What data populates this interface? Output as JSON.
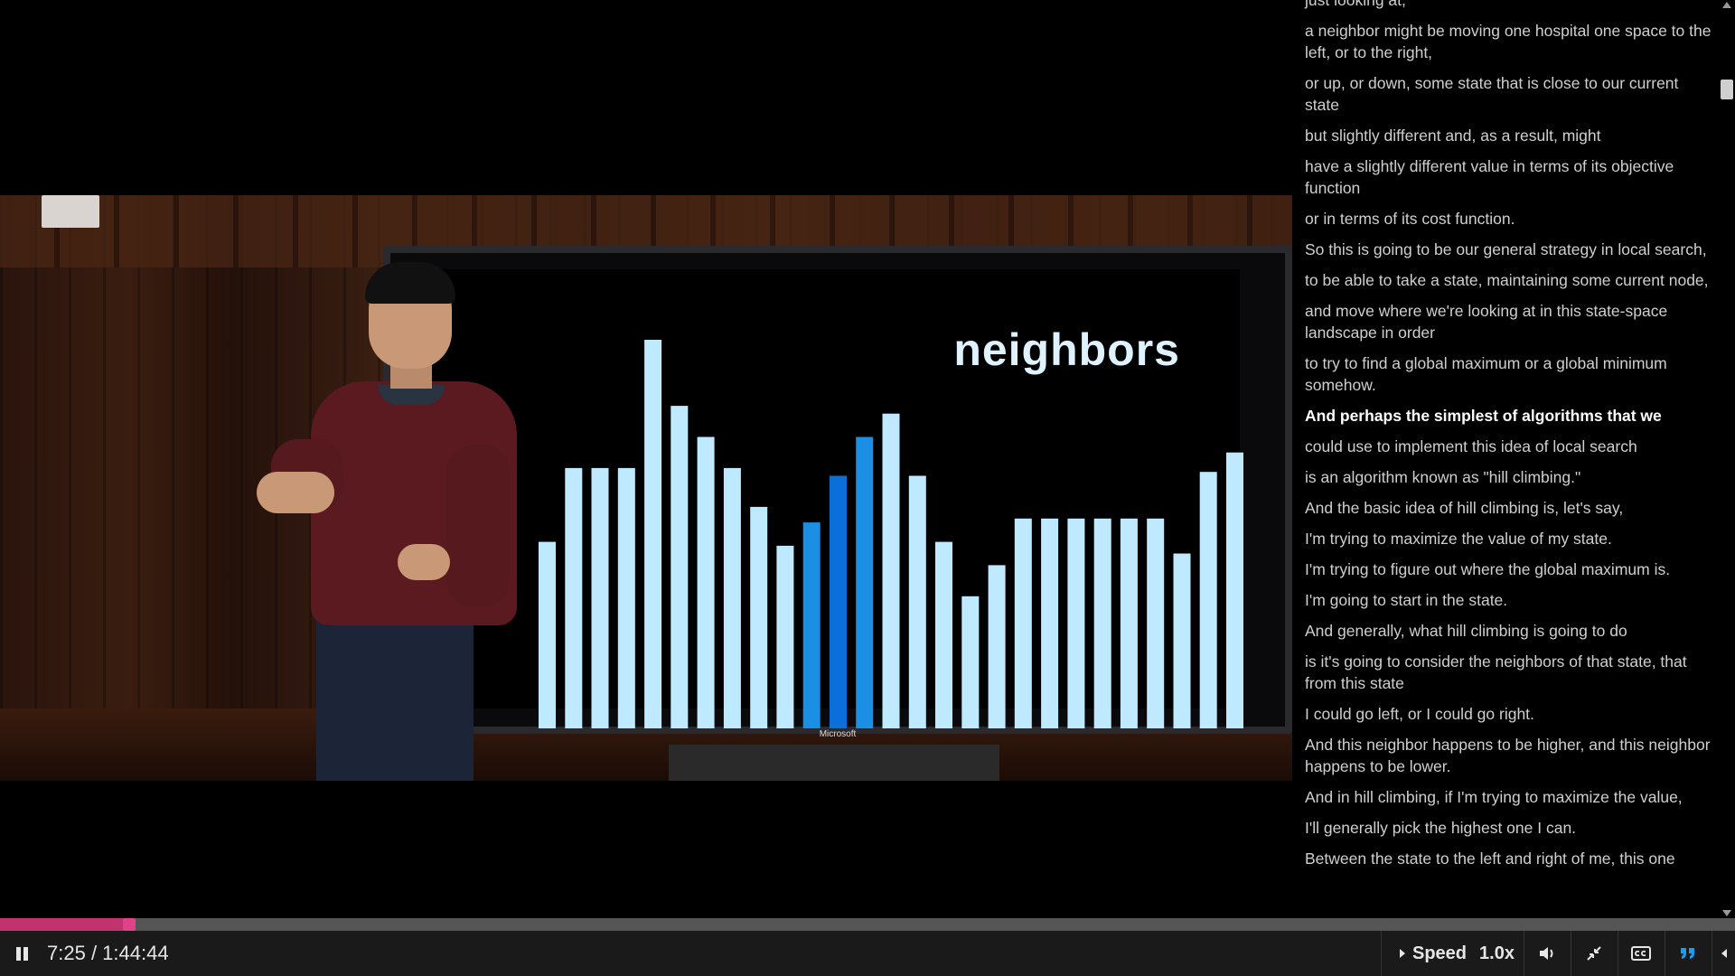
{
  "slide": {
    "title": "neighbors",
    "brand": "Microsoft"
  },
  "bars": {
    "values": [
      0.48,
      0.67,
      0.67,
      0.67,
      1.0,
      0.83,
      0.75,
      0.67,
      0.57,
      0.47,
      0.53,
      0.65,
      0.75,
      0.81,
      0.65,
      0.48,
      0.34,
      0.42,
      0.54,
      0.54,
      0.54,
      0.54,
      0.54,
      0.54,
      0.45,
      0.66,
      0.71
    ],
    "highlight": [
      10,
      11,
      12
    ],
    "colors": {
      "normal": "#bfe9ff",
      "highlight_light": "#1a8fe3",
      "highlight_dark": "#0a6fd8"
    }
  },
  "transcript": {
    "lines": [
      "just looking at,",
      "a neighbor might be moving one hospital one space to the left, or to the right,",
      "or up, or down, some state that is close to our current state",
      "but slightly different and, as a result, might",
      "have a slightly different value in terms of its objective function",
      "or in terms of its cost function.",
      "So this is going to be our general strategy in local search,",
      "to be able to take a state, maintaining some current node,",
      "and move where we're looking at in this state-space landscape in order",
      "to try to find a global maximum or a global minimum somehow.",
      "And perhaps the simplest of algorithms that we",
      "could use to implement this idea of local search",
      "is an algorithm known as \"hill climbing.\"",
      "And the basic idea of hill climbing is, let's say,",
      "I'm trying to maximize the value of my state.",
      "I'm trying to figure out where the global maximum is.",
      "I'm going to start in the state.",
      "And generally, what hill climbing is going to do",
      "is it's going to consider the neighbors of that state, that from this state",
      "I could go left, or I could go right.",
      "And this neighbor happens to be higher, and this neighbor happens to be lower.",
      "And in hill climbing, if I'm trying to maximize the value,",
      "I'll generally pick the highest one I can.",
      "Between the state to the left and right of me, this one"
    ],
    "active_index": 10
  },
  "player": {
    "current_time": "7:25",
    "duration": "1:44:44",
    "progress_fraction": 0.071,
    "speed_label": "Speed",
    "speed_value": "1.0x",
    "accent": "#c0336c",
    "icons": [
      "pause-icon",
      "volume-icon",
      "exit-fullscreen-icon",
      "closed-captions-icon",
      "transcript-icon",
      "collapse-icon"
    ]
  }
}
